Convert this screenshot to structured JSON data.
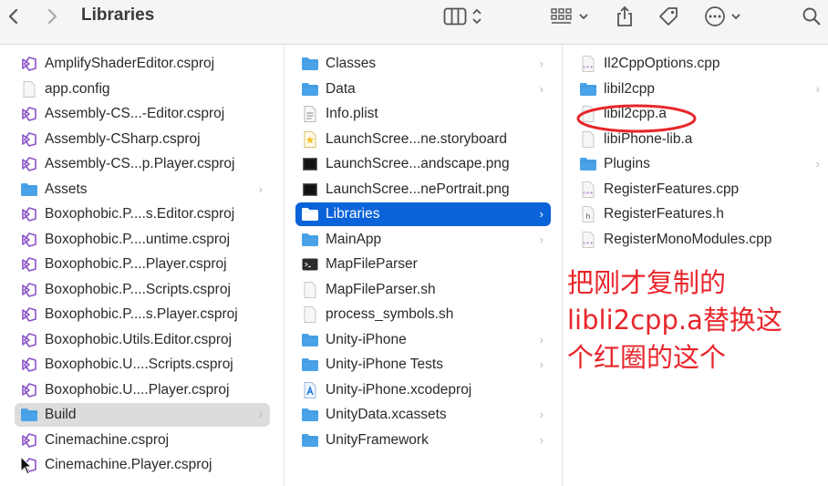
{
  "toolbar": {
    "title": "Libraries",
    "icons": [
      "back-chevron-icon",
      "forward-chevron-icon",
      "column-view-icon",
      "sort-chevrons-icon",
      "grid-view-icon",
      "dropdown-chevron-icon",
      "share-icon",
      "tag-icon",
      "more-icon",
      "dropdown-chevron-icon",
      "search-icon"
    ]
  },
  "column1": {
    "items": [
      {
        "label": "AmplifyShaderEditor.csproj",
        "icon": "csproj-icon"
      },
      {
        "label": "app.config",
        "icon": "file-icon"
      },
      {
        "label": "Assembly-CS...-Editor.csproj",
        "icon": "csproj-icon"
      },
      {
        "label": "Assembly-CSharp.csproj",
        "icon": "csproj-icon"
      },
      {
        "label": "Assembly-CS...p.Player.csproj",
        "icon": "csproj-icon"
      },
      {
        "label": "Assets",
        "icon": "folder-icon",
        "folder": true
      },
      {
        "label": "Boxophobic.P....s.Editor.csproj",
        "icon": "csproj-icon"
      },
      {
        "label": "Boxophobic.P....untime.csproj",
        "icon": "csproj-icon"
      },
      {
        "label": "Boxophobic.P....Player.csproj",
        "icon": "csproj-icon"
      },
      {
        "label": "Boxophobic.P....Scripts.csproj",
        "icon": "csproj-icon"
      },
      {
        "label": "Boxophobic.P....s.Player.csproj",
        "icon": "csproj-icon"
      },
      {
        "label": "Boxophobic.Utils.Editor.csproj",
        "icon": "csproj-icon"
      },
      {
        "label": "Boxophobic.U....Scripts.csproj",
        "icon": "csproj-icon"
      },
      {
        "label": "Boxophobic.U....Player.csproj",
        "icon": "csproj-icon"
      },
      {
        "label": "Build",
        "icon": "folder-icon",
        "folder": true,
        "selected": "gray"
      },
      {
        "label": "Cinemachine.csproj",
        "icon": "csproj-icon"
      },
      {
        "label": "Cinemachine.Player.csproj",
        "icon": "csproj-icon"
      }
    ]
  },
  "column2": {
    "items": [
      {
        "label": "Classes",
        "icon": "folder-icon",
        "folder": true
      },
      {
        "label": "Data",
        "icon": "folder-icon",
        "folder": true
      },
      {
        "label": "Info.plist",
        "icon": "plist-icon"
      },
      {
        "label": "LaunchScree...ne.storyboard",
        "icon": "storyboard-icon"
      },
      {
        "label": "LaunchScree...andscape.png",
        "icon": "image-icon"
      },
      {
        "label": "LaunchScree...nePortrait.png",
        "icon": "image-icon"
      },
      {
        "label": "Libraries",
        "icon": "folder-icon",
        "folder": true,
        "selected": "blue"
      },
      {
        "label": "MainApp",
        "icon": "folder-icon",
        "folder": true
      },
      {
        "label": "MapFileParser",
        "icon": "terminal-icon"
      },
      {
        "label": "MapFileParser.sh",
        "icon": "file-icon"
      },
      {
        "label": "process_symbols.sh",
        "icon": "file-icon"
      },
      {
        "label": "Unity-iPhone",
        "icon": "folder-icon",
        "folder": true
      },
      {
        "label": "Unity-iPhone Tests",
        "icon": "folder-icon",
        "folder": true
      },
      {
        "label": "Unity-iPhone.xcodeproj",
        "icon": "xcodeproj-icon"
      },
      {
        "label": "UnityData.xcassets",
        "icon": "folder-icon",
        "folder": true
      },
      {
        "label": "UnityFramework",
        "icon": "folder-icon",
        "folder": true
      }
    ]
  },
  "column3": {
    "items": [
      {
        "label": "Il2CppOptions.cpp",
        "icon": "cpp-icon"
      },
      {
        "label": "libil2cpp",
        "icon": "folder-icon",
        "folder": true
      },
      {
        "label": "libil2cpp.a",
        "icon": "file-icon"
      },
      {
        "label": "libiPhone-lib.a",
        "icon": "file-icon"
      },
      {
        "label": "Plugins",
        "icon": "folder-icon",
        "folder": true
      },
      {
        "label": "RegisterFeatures.cpp",
        "icon": "cpp-icon"
      },
      {
        "label": "RegisterFeatures.h",
        "icon": "header-icon"
      },
      {
        "label": "RegisterMonoModules.cpp",
        "icon": "cpp-icon"
      }
    ]
  },
  "annotation": {
    "lines": [
      "把刚才复制的",
      "libli2cpp.a替换这",
      "个红圈的这个"
    ],
    "color": "#e8262b"
  },
  "colors": {
    "selection_blue": "#0a63d8",
    "selection_gray": "#dcdcdc",
    "folder_blue": "#4aa3e8"
  }
}
